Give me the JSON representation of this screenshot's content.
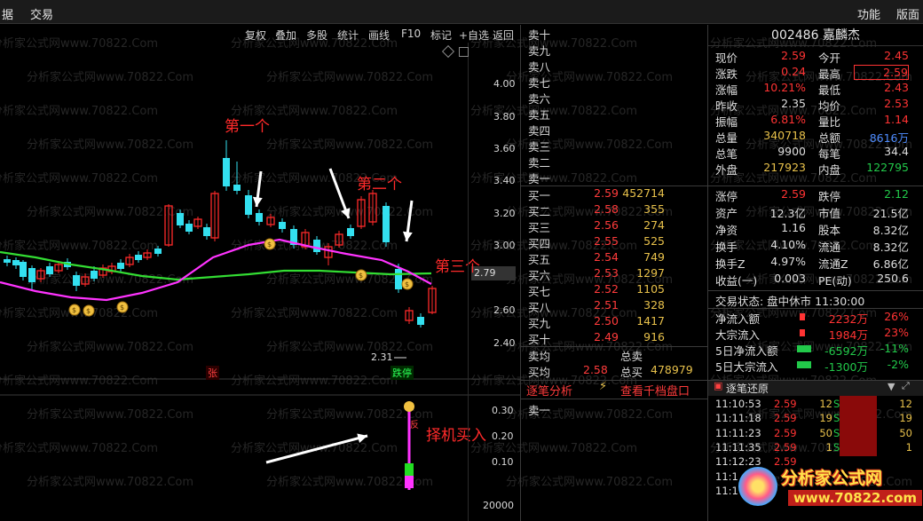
{
  "menubar": {
    "left_item_1": "据",
    "left_item_2": "交易",
    "right_item_1": "功能",
    "right_item_2": "版面"
  },
  "toolbar": [
    "复权",
    "叠加",
    "多股",
    "统计",
    "画线",
    "F10",
    "标记",
    "+自选",
    "返回"
  ],
  "chart": {
    "y_ticks": [
      "4.00",
      "3.80",
      "3.60",
      "3.40",
      "3.20",
      "3.00",
      "2.80",
      "2.60",
      "2.40"
    ],
    "current_price_label": "2.79",
    "low_label": "2.31",
    "zhang_mark": "张",
    "dieting_mark": "跌停",
    "annotations": {
      "first": "第一个",
      "second": "第二个",
      "third": "第三个",
      "buy": "择机买入"
    },
    "sub_y_ticks": [
      "0.30",
      "0.20",
      "0.10"
    ],
    "volume_label": "20000",
    "fan_mark": "反",
    "colors": {
      "up": "#ff2a2a",
      "down": "#33e0f0",
      "ma_pink": "#ff33ff",
      "ma_green": "#33dd33"
    }
  },
  "orderbook": {
    "sell_labels": [
      "卖十",
      "卖九",
      "卖八",
      "卖七",
      "卖六",
      "卖五",
      "卖四",
      "卖三",
      "卖二",
      "卖一"
    ],
    "buy": [
      {
        "label": "买一",
        "price": "2.59",
        "vol": "452714"
      },
      {
        "label": "买二",
        "price": "2.58",
        "vol": "355"
      },
      {
        "label": "买三",
        "price": "2.56",
        "vol": "274"
      },
      {
        "label": "买四",
        "price": "2.55",
        "vol": "525"
      },
      {
        "label": "买五",
        "price": "2.54",
        "vol": "749"
      },
      {
        "label": "买六",
        "price": "2.53",
        "vol": "1297"
      },
      {
        "label": "买七",
        "price": "2.52",
        "vol": "1105"
      },
      {
        "label": "买八",
        "price": "2.51",
        "vol": "328"
      },
      {
        "label": "买九",
        "price": "2.50",
        "vol": "1417"
      },
      {
        "label": "买十",
        "price": "2.49",
        "vol": "916"
      }
    ],
    "summary": {
      "sell_avg_label": "卖均",
      "total_sell_label": "总卖",
      "buy_avg_label": "买均",
      "buy_avg": "2.58",
      "total_buy_label": "总买",
      "total_buy": "478979"
    },
    "tab_analysis": "逐笔分析",
    "tab_view": "查看千档盘口",
    "sell_one": "卖一"
  },
  "quote": {
    "code_name": "002486 嘉麟杰",
    "rows": [
      [
        "现价",
        "2.59",
        "今开",
        "2.45"
      ],
      [
        "涨跌",
        "0.24",
        "最高",
        "2.59"
      ],
      [
        "涨幅",
        "10.21%",
        "最低",
        "2.43"
      ],
      [
        "昨收",
        "2.35",
        "均价",
        "2.53"
      ],
      [
        "振幅",
        "6.81%",
        "量比",
        "1.14"
      ],
      [
        "总量",
        "340718",
        "总额",
        "8616万"
      ],
      [
        "总笔",
        "9900",
        "每笔",
        "34.4"
      ],
      [
        "外盘",
        "217923",
        "内盘",
        "122795"
      ]
    ],
    "rows2": [
      [
        "涨停",
        "2.59",
        "跌停",
        "2.12"
      ],
      [
        "资产",
        "12.3亿",
        "市值",
        "21.5亿"
      ],
      [
        "净资",
        "1.16",
        "股本",
        "8.32亿"
      ],
      [
        "换手",
        "4.10%",
        "流通",
        "8.32亿"
      ],
      [
        "换手Z",
        "4.97%",
        "流通Z",
        "6.86亿"
      ],
      [
        "收益(一)",
        "0.003",
        "PE(动)",
        "250.6"
      ]
    ],
    "status": "交易状态: 盘中休市 11:30:00",
    "flows": [
      [
        "净流入额",
        "2232万",
        "26%"
      ],
      [
        "大宗流入",
        "1984万",
        "23%"
      ],
      [
        "5日净流入额",
        "-6592万",
        "-11%"
      ],
      [
        "5日大宗流入",
        "-1300万",
        "-2%"
      ]
    ],
    "ticks_title": "逐笔还原",
    "ticks": [
      [
        "11:10:53",
        "2.59",
        "12",
        "S",
        "12"
      ],
      [
        "11:11:18",
        "2.59",
        "19",
        "S",
        "19"
      ],
      [
        "11:11:23",
        "2.59",
        "50",
        "S",
        "50"
      ],
      [
        "11:11:35",
        "2.59",
        "1",
        "S",
        "1"
      ],
      [
        "11:12:23",
        "2.59",
        "",
        "",
        ""
      ],
      [
        "11:1",
        "",
        "",
        "",
        ""
      ],
      [
        "11:1",
        "",
        "",
        "",
        ""
      ]
    ],
    "logo_text": "分析家公式网",
    "logo_url": "www.70822.com"
  },
  "watermark": "分析家公式网www.70822.Com"
}
